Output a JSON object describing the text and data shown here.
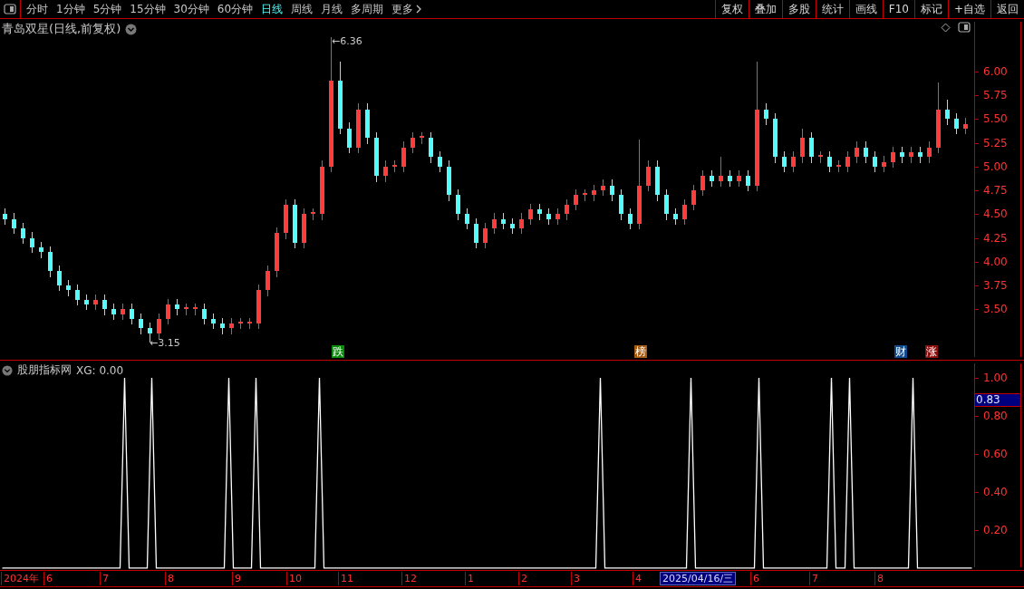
{
  "toolbar": {
    "periods": [
      {
        "label": "分时",
        "selected": false
      },
      {
        "label": "1分钟",
        "selected": false
      },
      {
        "label": "5分钟",
        "selected": false
      },
      {
        "label": "15分钟",
        "selected": false
      },
      {
        "label": "30分钟",
        "selected": false
      },
      {
        "label": "60分钟",
        "selected": false
      },
      {
        "label": "日线",
        "selected": true
      },
      {
        "label": "周线",
        "selected": false
      },
      {
        "label": "月线",
        "selected": false
      },
      {
        "label": "多周期",
        "selected": false
      }
    ],
    "more": "更多",
    "actions": [
      "复权",
      "叠加",
      "多股",
      "统计",
      "画线",
      "F10",
      "标记",
      "+自选",
      "返回"
    ]
  },
  "price_panel": {
    "title": "青岛双星(日线,前复权)",
    "chart_data": {
      "type": "candlestick",
      "ylim": [
        2.97,
        6.55
      ],
      "yticks": [
        {
          "value": 6,
          "label": "6.00"
        },
        {
          "value": 5.75,
          "label": "5.75"
        },
        {
          "value": 5.5,
          "label": "5.50"
        },
        {
          "value": 5.25,
          "label": "5.25"
        },
        {
          "value": 5,
          "label": "5.00"
        },
        {
          "value": 4.75,
          "label": "4.75"
        },
        {
          "value": 4.5,
          "label": "4.50"
        },
        {
          "value": 4.25,
          "label": "4.25"
        },
        {
          "value": 4,
          "label": "4.00"
        },
        {
          "value": 3.75,
          "label": "3.75"
        },
        {
          "value": 3.5,
          "label": "3.50"
        }
      ],
      "categories": [
        null,
        null,
        null,
        null,
        null,
        null,
        null,
        null,
        null,
        null,
        null,
        null,
        null,
        null,
        null,
        null,
        null,
        null,
        null,
        null,
        null,
        null,
        null,
        null,
        null,
        null,
        null,
        null,
        null,
        null,
        null,
        null,
        null,
        null,
        null,
        null,
        null,
        null,
        null,
        null,
        null,
        null,
        null,
        null,
        null,
        null,
        null,
        null,
        null,
        null,
        null,
        null,
        null,
        null,
        null,
        null,
        null,
        null,
        null,
        null,
        null,
        null,
        null,
        null,
        null,
        null,
        null,
        null,
        null,
        null,
        null,
        null,
        null,
        null,
        null,
        null,
        null,
        null,
        null,
        null,
        null,
        null,
        null,
        null,
        null,
        null,
        null,
        null,
        null,
        null,
        null,
        null,
        null,
        null,
        null,
        null,
        null,
        null,
        null,
        null,
        null,
        null,
        null,
        null,
        null,
        null,
        null
      ],
      "ohlc": [
        [
          4.5,
          4.56,
          4.39,
          4.45
        ],
        [
          4.45,
          4.51,
          4.29,
          4.35
        ],
        [
          4.35,
          4.41,
          4.19,
          4.25
        ],
        [
          4.25,
          4.31,
          4.09,
          4.15
        ],
        [
          4.15,
          4.21,
          4.04,
          4.1
        ],
        [
          4.1,
          4.16,
          3.84,
          3.9
        ],
        [
          3.9,
          3.96,
          3.69,
          3.75
        ],
        [
          3.75,
          3.81,
          3.64,
          3.7
        ],
        [
          3.7,
          3.76,
          3.54,
          3.6
        ],
        [
          3.6,
          3.66,
          3.49,
          3.55
        ],
        [
          3.55,
          3.66,
          3.49,
          3.6
        ],
        [
          3.6,
          3.66,
          3.44,
          3.5
        ],
        [
          3.5,
          3.56,
          3.39,
          3.45
        ],
        [
          3.45,
          3.56,
          3.39,
          3.5
        ],
        [
          3.5,
          3.56,
          3.34,
          3.4
        ],
        [
          3.4,
          3.46,
          3.24,
          3.3
        ],
        [
          3.3,
          3.36,
          3.15,
          3.25
        ],
        [
          3.25,
          3.46,
          3.19,
          3.4
        ],
        [
          3.4,
          3.61,
          3.34,
          3.55
        ],
        [
          3.55,
          3.61,
          3.44,
          3.5
        ],
        [
          3.5,
          3.56,
          3.44,
          3.52
        ],
        [
          3.5,
          3.56,
          3.44,
          3.52
        ],
        [
          3.5,
          3.56,
          3.34,
          3.4
        ],
        [
          3.4,
          3.46,
          3.29,
          3.35
        ],
        [
          3.35,
          3.41,
          3.24,
          3.3
        ],
        [
          3.3,
          3.41,
          3.24,
          3.35
        ],
        [
          3.35,
          3.41,
          3.29,
          3.37
        ],
        [
          3.35,
          3.41,
          3.29,
          3.37
        ],
        [
          3.35,
          3.76,
          3.29,
          3.7
        ],
        [
          3.7,
          3.96,
          3.64,
          3.9
        ],
        [
          3.9,
          4.36,
          3.84,
          4.3
        ],
        [
          4.3,
          4.66,
          4.24,
          4.6
        ],
        [
          4.6,
          4.66,
          4.14,
          4.2
        ],
        [
          4.2,
          4.56,
          4.14,
          4.5
        ],
        [
          4.5,
          4.56,
          4.44,
          4.52
        ],
        [
          4.5,
          5.06,
          4.44,
          5.0
        ],
        [
          5.0,
          6.36,
          4.94,
          5.9
        ],
        [
          5.9,
          6.1,
          5.34,
          5.4
        ],
        [
          5.4,
          5.46,
          5.14,
          5.2
        ],
        [
          5.2,
          5.66,
          5.14,
          5.6
        ],
        [
          5.6,
          5.66,
          5.24,
          5.3
        ],
        [
          5.3,
          5.36,
          4.84,
          4.9
        ],
        [
          4.9,
          5.06,
          4.84,
          5.0
        ],
        [
          5.0,
          5.06,
          4.94,
          5.02
        ],
        [
          5.0,
          5.26,
          4.94,
          5.2
        ],
        [
          5.2,
          5.36,
          5.14,
          5.3
        ],
        [
          5.3,
          5.36,
          5.24,
          5.32
        ],
        [
          5.3,
          5.36,
          5.04,
          5.1
        ],
        [
          5.1,
          5.16,
          4.94,
          5.0
        ],
        [
          5.0,
          5.06,
          4.64,
          4.7
        ],
        [
          4.7,
          4.76,
          4.44,
          4.5
        ],
        [
          4.5,
          4.56,
          4.34,
          4.4
        ],
        [
          4.4,
          4.46,
          4.14,
          4.2
        ],
        [
          4.2,
          4.41,
          4.14,
          4.35
        ],
        [
          4.35,
          4.51,
          4.29,
          4.45
        ],
        [
          4.45,
          4.51,
          4.34,
          4.4
        ],
        [
          4.4,
          4.46,
          4.29,
          4.35
        ],
        [
          4.35,
          4.51,
          4.29,
          4.45
        ],
        [
          4.45,
          4.61,
          4.39,
          4.55
        ],
        [
          4.55,
          4.61,
          4.44,
          4.5
        ],
        [
          4.5,
          4.56,
          4.39,
          4.45
        ],
        [
          4.45,
          4.56,
          4.39,
          4.5
        ],
        [
          4.5,
          4.66,
          4.44,
          4.6
        ],
        [
          4.6,
          4.76,
          4.54,
          4.7
        ],
        [
          4.7,
          4.76,
          4.64,
          4.72
        ],
        [
          4.7,
          4.81,
          4.64,
          4.75
        ],
        [
          4.75,
          4.86,
          4.69,
          4.8
        ],
        [
          4.8,
          4.86,
          4.64,
          4.7
        ],
        [
          4.7,
          4.76,
          4.44,
          4.5
        ],
        [
          4.5,
          4.56,
          4.34,
          4.4
        ],
        [
          4.4,
          5.28,
          4.34,
          4.8
        ],
        [
          4.8,
          5.06,
          4.74,
          5.0
        ],
        [
          5.0,
          5.06,
          4.64,
          4.7
        ],
        [
          4.7,
          4.76,
          4.44,
          4.5
        ],
        [
          4.5,
          4.56,
          4.39,
          4.45
        ],
        [
          4.45,
          4.66,
          4.39,
          4.6
        ],
        [
          4.6,
          4.81,
          4.54,
          4.75
        ],
        [
          4.75,
          4.96,
          4.69,
          4.9
        ],
        [
          4.9,
          4.96,
          4.79,
          4.85
        ],
        [
          4.85,
          5.1,
          4.79,
          4.9
        ],
        [
          4.9,
          4.96,
          4.79,
          4.85
        ],
        [
          4.85,
          4.96,
          4.79,
          4.9
        ],
        [
          4.9,
          4.96,
          4.74,
          4.8
        ],
        [
          4.8,
          6.1,
          4.74,
          5.6
        ],
        [
          5.6,
          5.66,
          5.44,
          5.5
        ],
        [
          5.5,
          5.56,
          5.04,
          5.1
        ],
        [
          5.1,
          5.16,
          4.94,
          5.0
        ],
        [
          5.0,
          5.16,
          4.94,
          5.1
        ],
        [
          5.1,
          5.4,
          5.04,
          5.3
        ],
        [
          5.3,
          5.36,
          5.04,
          5.1
        ],
        [
          5.1,
          5.16,
          5.04,
          5.12
        ],
        [
          5.1,
          5.16,
          4.94,
          5.0
        ],
        [
          5.0,
          5.06,
          4.94,
          5.02
        ],
        [
          5.0,
          5.16,
          4.94,
          5.1
        ],
        [
          5.1,
          5.26,
          5.04,
          5.2
        ],
        [
          5.2,
          5.26,
          5.04,
          5.1
        ],
        [
          5.1,
          5.16,
          4.94,
          5.0
        ],
        [
          5.0,
          5.11,
          4.94,
          5.05
        ],
        [
          5.05,
          5.21,
          4.99,
          5.15
        ],
        [
          5.15,
          5.21,
          5.04,
          5.1
        ],
        [
          5.1,
          5.21,
          5.04,
          5.15
        ],
        [
          5.15,
          5.21,
          5.04,
          5.1
        ],
        [
          5.1,
          5.26,
          5.04,
          5.2
        ],
        [
          5.2,
          5.88,
          5.14,
          5.6
        ],
        [
          5.6,
          5.7,
          5.44,
          5.5
        ],
        [
          5.5,
          5.56,
          5.34,
          5.4
        ],
        [
          5.4,
          5.51,
          5.34,
          5.45
        ]
      ],
      "annotations": [
        "←6.36",
        "←3.15"
      ]
    },
    "event_tags": [
      {
        "label": "跌",
        "color": "#0a8a0a"
      },
      {
        "label": "榜",
        "color": "#a55a10"
      },
      {
        "label": "财",
        "color": "#104a8a"
      },
      {
        "label": "涨",
        "color": "#8a1010"
      }
    ]
  },
  "indicator_panel": {
    "name": "股朋指标网",
    "reading": "XG: 0.00",
    "cursor_readout": "0.83",
    "chart_data": {
      "type": "line",
      "ylim": [
        -0.01,
        1.09
      ],
      "yticks": [
        {
          "value": 1,
          "label": "1.00"
        },
        {
          "value": 0.8,
          "label": "0.80"
        },
        {
          "value": 0.6,
          "label": "0.60"
        },
        {
          "value": 0.4,
          "label": "0.40"
        },
        {
          "value": 0.2,
          "label": "0.20"
        }
      ],
      "categories": [
        null,
        null,
        null,
        null,
        null,
        null,
        null,
        null,
        null,
        null,
        null,
        null,
        null,
        null,
        null,
        null,
        null,
        null,
        null,
        null,
        null,
        null,
        null,
        null,
        null,
        null,
        null,
        null,
        null,
        null,
        null,
        null,
        null,
        null,
        null,
        null,
        null,
        null,
        null,
        null,
        null,
        null,
        null,
        null,
        null,
        null,
        null,
        null,
        null,
        null,
        null,
        null,
        null,
        null,
        null,
        null,
        null,
        null,
        null,
        null,
        null,
        null,
        null,
        null,
        null,
        null,
        null,
        null,
        null,
        null,
        null,
        null,
        null,
        null,
        null,
        null,
        null,
        null,
        null,
        null,
        null,
        null,
        null,
        null,
        null,
        null,
        null,
        null,
        null,
        null,
        null,
        null,
        null,
        null,
        null,
        null,
        null,
        null,
        null,
        null,
        null,
        null,
        null,
        null,
        null,
        null,
        null,
        null,
        null,
        null,
        null,
        null,
        null,
        null,
        null,
        null,
        null,
        null,
        null,
        null,
        null,
        null,
        null,
        null,
        null,
        null,
        null,
        null,
        null,
        null,
        null,
        null,
        null,
        null,
        null,
        null,
        null,
        null,
        null,
        null,
        null,
        null,
        null,
        null,
        null,
        null,
        null,
        null,
        null,
        null,
        null,
        null,
        null,
        null,
        null,
        null,
        null,
        null,
        null,
        null,
        null,
        null,
        null,
        null,
        null,
        null,
        null,
        null,
        null,
        null,
        null,
        null,
        null,
        null,
        null,
        null,
        null,
        null,
        null,
        null,
        null,
        null,
        null,
        null,
        null,
        null,
        null,
        null,
        null,
        null,
        null,
        null,
        null,
        null,
        null,
        null,
        null,
        null,
        null,
        null,
        null,
        null,
        null,
        null,
        null,
        null,
        null,
        null,
        null,
        null,
        null,
        null,
        null,
        null,
        null
      ],
      "values": [
        0,
        0,
        0,
        0,
        0,
        0,
        0,
        0,
        0,
        0,
        0,
        0,
        0,
        0,
        0,
        0,
        0,
        0,
        0,
        0,
        0,
        0,
        0,
        0,
        0,
        0,
        0,
        1,
        0,
        0,
        0,
        0,
        0,
        1,
        0,
        0,
        0,
        0,
        0,
        0,
        0,
        0,
        0,
        0,
        0,
        0,
        0,
        0,
        0,
        0,
        1,
        0,
        0,
        0,
        0,
        0,
        1,
        0,
        0,
        0,
        0,
        0,
        0,
        0,
        0,
        0,
        0,
        0,
        0,
        0,
        1,
        0,
        0,
        0,
        0,
        0,
        0,
        0,
        0,
        0,
        0,
        0,
        0,
        0,
        0,
        0,
        0,
        0,
        0,
        0,
        0,
        0,
        0,
        0,
        0,
        0,
        0,
        0,
        0,
        0,
        0,
        0,
        0,
        0,
        0,
        0,
        0,
        0,
        0,
        0,
        0,
        0,
        0,
        0,
        0,
        0,
        0,
        0,
        0,
        0,
        0,
        0,
        0,
        0,
        0,
        0,
        0,
        0,
        0,
        0,
        0,
        0,
        1,
        0,
        0,
        0,
        0,
        0,
        0,
        0,
        0,
        0,
        0,
        0,
        0,
        0,
        0,
        0,
        0,
        0,
        0,
        0,
        1,
        0,
        0,
        0,
        0,
        0,
        0,
        0,
        0,
        0,
        0,
        0,
        0,
        0,
        0,
        1,
        0,
        0,
        0,
        0,
        0,
        0,
        0,
        0,
        0,
        0,
        0,
        0,
        0,
        0,
        0,
        1,
        0,
        0,
        0,
        1,
        0,
        0,
        0,
        0,
        0,
        0,
        0,
        0,
        0,
        0,
        0,
        0,
        0,
        1,
        0,
        0,
        0,
        0,
        0,
        0,
        0,
        0,
        0,
        0,
        0,
        0,
        0
      ]
    }
  },
  "date_axis": {
    "labels": [
      {
        "label": "2024年",
        "selected": false
      },
      {
        "label": "6",
        "selected": false
      },
      {
        "label": "7",
        "selected": false
      },
      {
        "label": "8",
        "selected": false
      },
      {
        "label": "9",
        "selected": false
      },
      {
        "label": "10",
        "selected": false
      },
      {
        "label": "11",
        "selected": false
      },
      {
        "label": "12",
        "selected": false
      },
      {
        "label": "1",
        "selected": false
      },
      {
        "label": "2",
        "selected": false
      },
      {
        "label": "3",
        "selected": false
      },
      {
        "label": "4",
        "selected": false
      },
      {
        "label": "2025/04/16/三",
        "selected": true
      },
      {
        "label": "6",
        "selected": false
      },
      {
        "label": "7",
        "selected": false
      },
      {
        "label": "8",
        "selected": false
      }
    ]
  }
}
